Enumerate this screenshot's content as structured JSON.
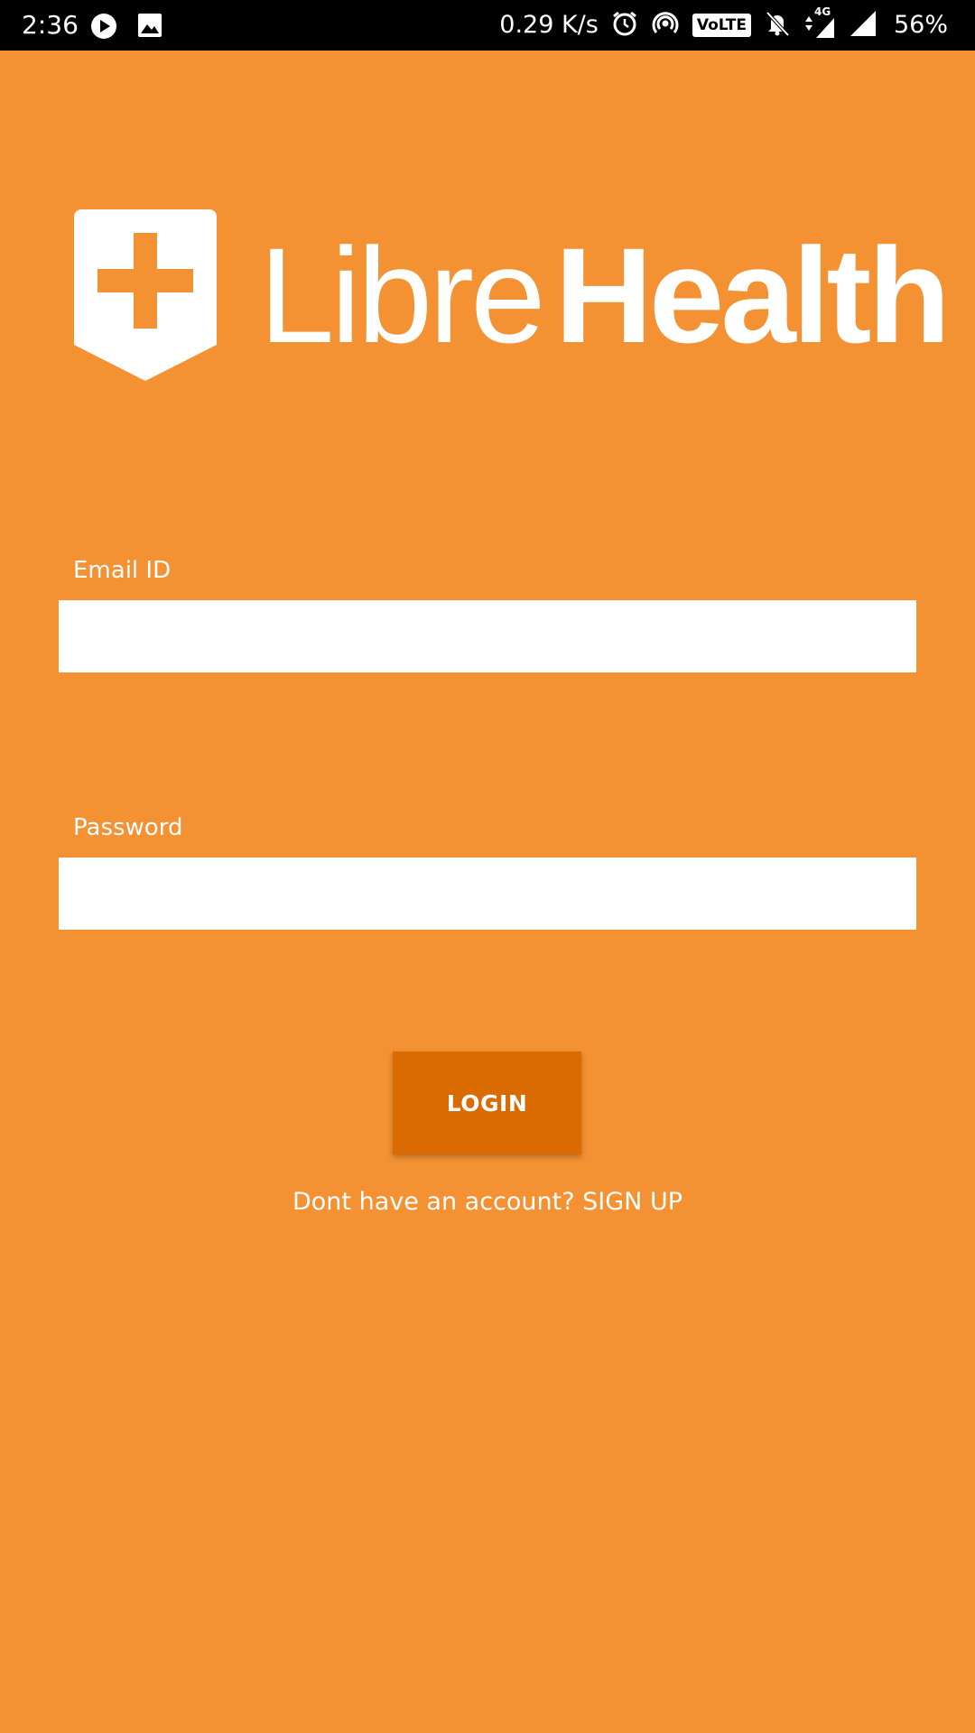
{
  "status_bar": {
    "time": "2:36",
    "network_speed": "0.29 K/s",
    "volte": "VoLTE",
    "network_type": "4G",
    "battery": "56%",
    "icons": [
      "play-icon",
      "image-icon",
      "alarm-icon",
      "hotspot-icon",
      "volte-icon",
      "bell-off-icon",
      "data-arrows-icon",
      "signal-icon",
      "signal-icon"
    ]
  },
  "logo": {
    "part1": "Libre",
    "part2": "Health"
  },
  "form": {
    "email_label": "Email ID",
    "email_value": "",
    "password_label": "Password",
    "password_value": "",
    "login_label": "LOGIN",
    "signup_prompt": "Dont have an account?",
    "signup_link": "SIGN UP"
  },
  "colors": {
    "background": "#F39133",
    "button": "#D96B00",
    "input": "#FFFFFF",
    "text": "#FFFFFF"
  }
}
